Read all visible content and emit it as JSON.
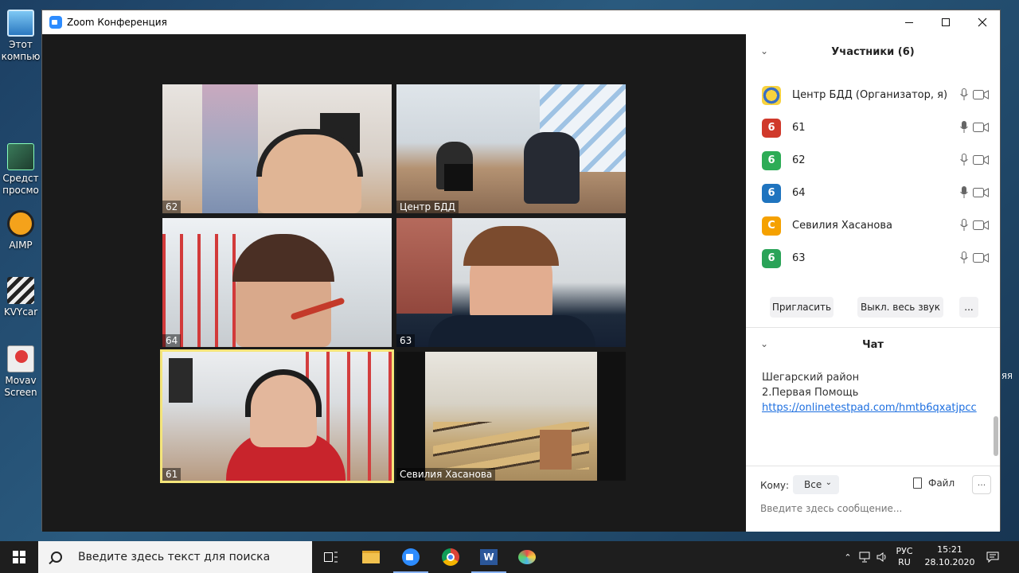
{
  "desktop": {
    "icons": [
      {
        "label_line1": "Этот",
        "label_line2": "компью"
      },
      {
        "label_line1": "Средст",
        "label_line2": "просмо"
      },
      {
        "label_line1": "AIMP",
        "label_line2": ""
      },
      {
        "label_line1": "KVYcar",
        "label_line2": ""
      },
      {
        "label_line1": "Movav",
        "label_line2": "Screen"
      }
    ],
    "right_fragment": "ЯЯ"
  },
  "window": {
    "title": "Zoom Конференция"
  },
  "videos": [
    {
      "name": "62"
    },
    {
      "name": "Центр БДД"
    },
    {
      "name": "64"
    },
    {
      "name": "63"
    },
    {
      "name": "61"
    },
    {
      "name": "Севилия Хасанова"
    }
  ],
  "participants": {
    "header": "Участники (6)",
    "list": [
      {
        "avatar": "",
        "name": "Центр БДД (Организатор, я)",
        "color": "#f0c419"
      },
      {
        "avatar": "6",
        "name": "61",
        "color": "#d0392b"
      },
      {
        "avatar": "6",
        "name": "62",
        "color": "#2dac56"
      },
      {
        "avatar": "6",
        "name": "64",
        "color": "#1f74bf"
      },
      {
        "avatar": "С",
        "name": "Севилия Хасанова",
        "color": "#f5a100"
      },
      {
        "avatar": "6",
        "name": "63",
        "color": "#2aa358"
      }
    ],
    "invite_label": "Пригласить",
    "mute_all_label": "Выкл. весь звук",
    "more_label": "..."
  },
  "chat": {
    "header": "Чат",
    "messages": [
      {
        "line1": "Шегарский район",
        "line2": "2.Первая Помощь",
        "link": "https://onlinetestpad.com/hmtb6qxatjpcc"
      }
    ],
    "to_label": "Кому:",
    "to_value": "Все",
    "file_label": "Файл",
    "placeholder": "Введите здесь сообщение..."
  },
  "taskbar": {
    "search_placeholder": "Введите здесь текст для поиска",
    "lang_line1": "РУС",
    "lang_line2": "RU",
    "time": "15:21",
    "date": "28.10.2020"
  }
}
